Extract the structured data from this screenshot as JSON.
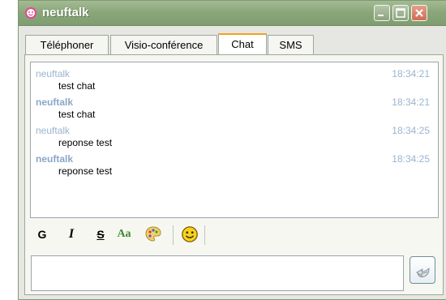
{
  "window": {
    "title": "neuftalk"
  },
  "tabs": [
    {
      "label": "Téléphoner"
    },
    {
      "label": "Visio-conférence"
    },
    {
      "label": "Chat"
    },
    {
      "label": "SMS"
    }
  ],
  "chat": {
    "messages": [
      {
        "sender": "neuftalk",
        "time": "18:34:21",
        "text": "test chat"
      },
      {
        "sender": "neuftalk",
        "time": "18:34:21",
        "text": "test chat"
      },
      {
        "sender": "neuftalk",
        "time": "18:34:25",
        "text": "reponse test"
      },
      {
        "sender": "neuftalk",
        "time": "18:34:25",
        "text": "reponse test"
      }
    ]
  },
  "toolbar": {
    "bold_label": "G",
    "italic_label": "I",
    "strike_label": "S",
    "font_label": "Aa",
    "color_icon": "palette-icon",
    "emoticon_icon": "smiley-icon"
  },
  "input": {
    "value": ""
  },
  "colors": {
    "titlebar": "#8aa77a",
    "active_tab_accent": "#f2a21e",
    "sender": "#9bb4cf"
  }
}
